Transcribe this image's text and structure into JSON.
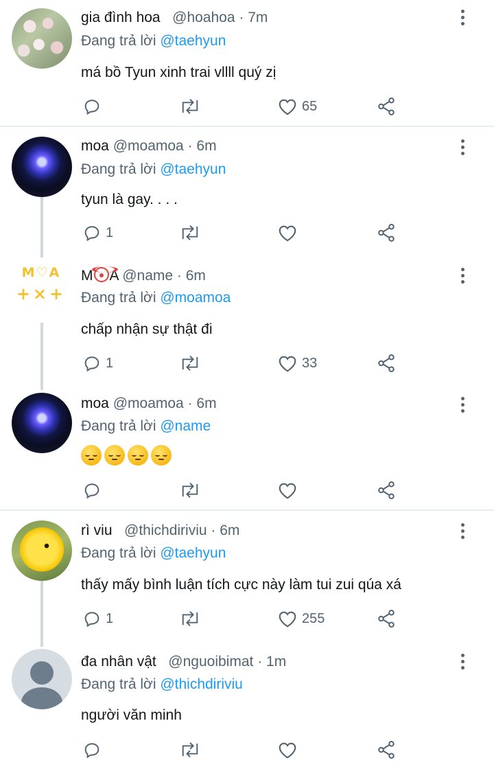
{
  "colors": {
    "mention": "#1d9bf0",
    "secondary": "#536471",
    "divider": "#e6ecf0",
    "thread": "#cfd9de"
  },
  "tweets": [
    {
      "name": "gia đình hoa",
      "handle": "@hoahoa",
      "time": "· 7m",
      "reply_prefix": "Đang trả lời",
      "reply_to": "@taehyun",
      "text": "má bồ Tyun xinh trai vllll quý zị",
      "replies": "",
      "retweets": "",
      "likes": "65"
    },
    {
      "name": "moa",
      "handle": "@moamoa",
      "time": "· 6m",
      "reply_prefix": "Đang trả lời",
      "reply_to": "@taehyun",
      "text": "tyun là gay. . . .",
      "replies": "1",
      "retweets": "",
      "likes": ""
    },
    {
      "name_pre": "M",
      "name_post": "A",
      "name_emoji": "clown-face",
      "handle": "@name",
      "time": "· 6m",
      "reply_prefix": "Đang trả lời",
      "reply_to": "@moamoa",
      "text": "chấp nhận sự thật đi",
      "replies": "1",
      "retweets": "",
      "likes": "33",
      "avatar_text_top": "M♡A",
      "avatar_text_bottom": "+×+"
    },
    {
      "name": "moa",
      "handle": "@moamoa",
      "time": "· 6m",
      "reply_prefix": "Đang trả lời",
      "reply_to": "@name",
      "text_emoji": [
        "pensive-face",
        "pensive-face",
        "pensive-face",
        "pensive-face"
      ],
      "replies": "",
      "retweets": "",
      "likes": ""
    },
    {
      "name": "rì viu",
      "handle": "@thichdiriviu",
      "time": "· 6m",
      "reply_prefix": "Đang trả lời",
      "reply_to": "@taehyun",
      "text": "thấy mấy bình luận tích cực này làm tui zui qúa xá",
      "replies": "1",
      "retweets": "",
      "likes": "255"
    },
    {
      "name": "đa nhân vật",
      "handle": "@nguoibimat",
      "time": "· 1m",
      "reply_prefix": "Đang trả lời",
      "reply_to": "@thichdiriviu",
      "text": "người văn minh",
      "replies": "",
      "retweets": "",
      "likes": ""
    }
  ]
}
